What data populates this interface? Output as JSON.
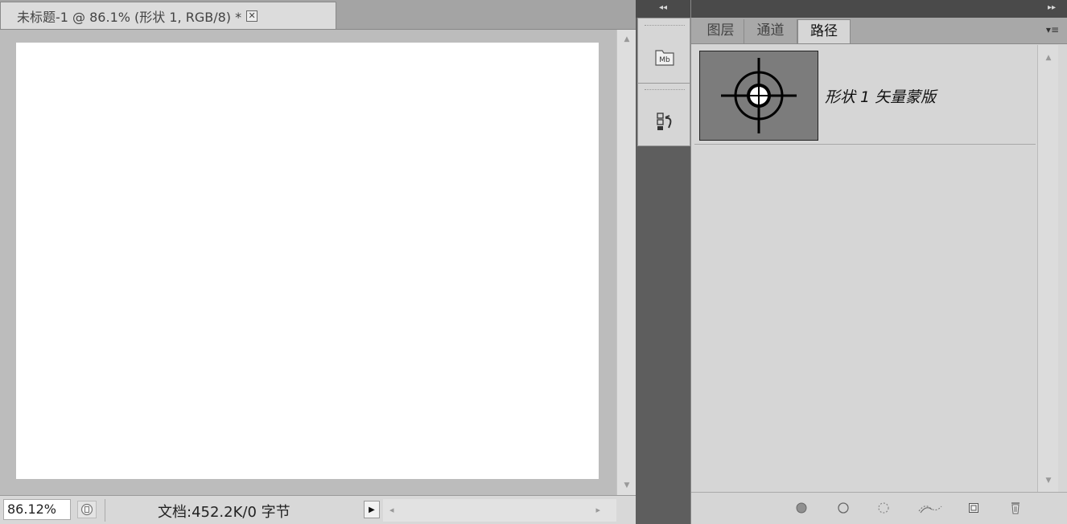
{
  "document": {
    "tab_title": "未标题-1 @ 86.1% (形状 1, RGB/8) *",
    "close_glyph": "✕"
  },
  "status_bar": {
    "zoom": "86.12%",
    "doc_info": "文档:452.2K/0 字节",
    "menu_glyph": "▶"
  },
  "dock": {
    "collapse_glyph": "◂◂",
    "buttons": [
      {
        "name": "mini-bridge",
        "icon": "mini-bridge-icon",
        "label": "Mb"
      },
      {
        "name": "history",
        "icon": "history-icon"
      }
    ]
  },
  "panel": {
    "expand_glyph": "▸▸",
    "menu_glyph": "▾≡",
    "tabs": [
      {
        "label": "图层",
        "active": false
      },
      {
        "label": "通道",
        "active": false
      },
      {
        "label": "路径",
        "active": true
      }
    ],
    "paths": [
      {
        "name": "形状 1 矢量蒙版",
        "thumbnail": "crosshair-target-icon"
      }
    ],
    "footer_buttons": [
      {
        "name": "fill-path",
        "icon": "fill-path-icon"
      },
      {
        "name": "stroke-path",
        "icon": "stroke-path-icon"
      },
      {
        "name": "load-as-selection",
        "icon": "load-selection-icon"
      },
      {
        "name": "make-work-path",
        "icon": "make-work-path-icon"
      },
      {
        "name": "new-path",
        "icon": "new-path-icon"
      },
      {
        "name": "delete-path",
        "icon": "trash-icon"
      }
    ]
  },
  "colors": {
    "workspace": "#6a6a6a",
    "canvas": "#ffffff",
    "panel_bg": "#d6d6d6",
    "thumb_bg": "#7c7c7c"
  }
}
